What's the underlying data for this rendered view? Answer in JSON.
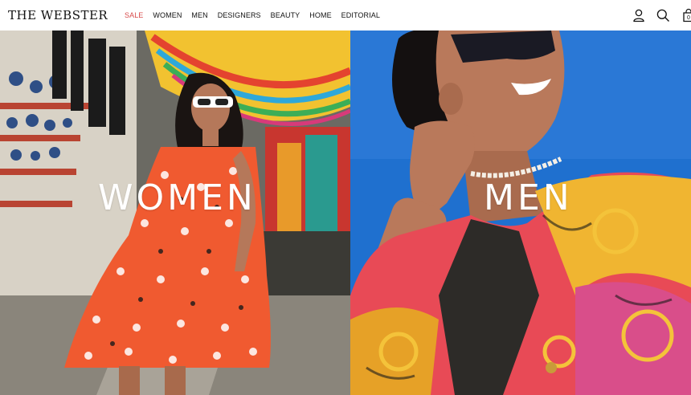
{
  "brand": {
    "logo_text": "THE WEBSTER"
  },
  "nav": {
    "items": [
      {
        "label": "SALE",
        "highlight": true
      },
      {
        "label": "WOMEN",
        "highlight": false
      },
      {
        "label": "MEN",
        "highlight": false
      },
      {
        "label": "DESIGNERS",
        "highlight": false
      },
      {
        "label": "BEAUTY",
        "highlight": false
      },
      {
        "label": "HOME",
        "highlight": false
      },
      {
        "label": "EDITORIAL",
        "highlight": false
      }
    ]
  },
  "header_icons": [
    "account-icon",
    "search-icon",
    "shopping-bag-icon"
  ],
  "cart": {
    "count": "0"
  },
  "heroes": {
    "women": {
      "label": "WOMEN"
    },
    "men": {
      "label": "MEN"
    }
  },
  "colors": {
    "sale": "#d84a4a",
    "text": "#111111",
    "sky_blue": "#1f6fcc"
  }
}
